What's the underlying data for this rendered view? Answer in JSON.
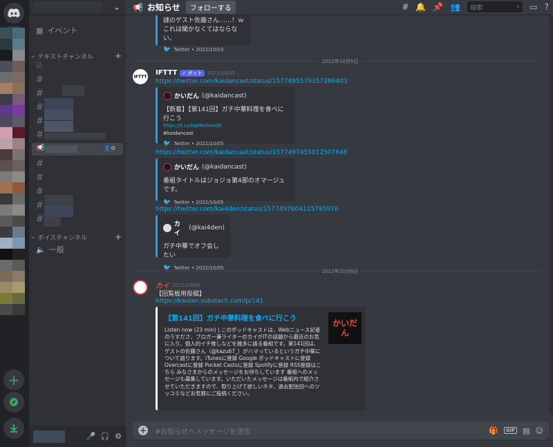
{
  "header": {
    "channel_title": "お知らせ",
    "follow_label": "フォローする",
    "search_placeholder": "検索"
  },
  "sidebar": {
    "event_label": "イベント",
    "text_category": "テキストチャンネル",
    "voice_category": "ボイスチャンネル",
    "voice_channel": "一般"
  },
  "messages": {
    "top_embed": {
      "line1": "謎のゲスト佐藤さん……！ｗ",
      "line2": "これは聞かなくてはならない。",
      "footer": "Twitter • 2022/10/03"
    },
    "date1": "2022年10月5日",
    "ifttt": {
      "name": "IFTTT",
      "bot_badge": "✓ ボット",
      "timestamp": "2022/10/05",
      "link1": "https://twitter.com/kaidancast/status/1577495579357286403",
      "embed1": {
        "author": "かいだん",
        "handle": "(@kaidancast)",
        "text": "【新着】【第141回】ガチ中華料理を食べに行こう",
        "link": "https://t.co/tqeMnhexQE",
        "tag": "#kaidancast",
        "footer": "Twitter • 2022/10/05"
      },
      "link2": "https://twitter.com/kaidancast/status/1577497455012507648",
      "embed2": {
        "author": "かいだん",
        "handle": "(@kaidancast)",
        "text": "番組タイトルはジョジョ第4部のオマージュです。",
        "footer": "Twitter • 2022/10/05"
      },
      "link3": "https://twitter.com/kai4den/status/1577497604115795976",
      "embed3": {
        "author": "カイ",
        "handle": "(@kai4den)",
        "text": "ガチ中華でオフ会したい",
        "footer": "Twitter • 2022/10/05"
      }
    },
    "date2": "2022年10月6日",
    "kai": {
      "name": "カイ",
      "timestamp": "2022/10/06",
      "text": "【回覧板用投稿】",
      "link": "https://kaidan.substack.com/p/141",
      "embed": {
        "title": "【第141回】ガチ中華料理を食べに行こう",
        "body": "Listen now (23 min) | このポッドキャストは、Webニュース記者のうすださ、ブロガー兼ライターのカイがITの話題から最近のお気に入り、個人的イチ推しなどを雑多に語る番組です。第141回は、ゲストの佐藤さん（@kazu67_）がハマっているというガチ中華について語ります。iTunesに登録 Google ポッドキャストに登録 Overcastに登録 Pocket Castsに登録 Spotifyに登録 RSS登録はこちら みなさまからのメッセージをお待ちしています 番組へのメッセージも募集しています。いただいたメッセージは番組内で紹介させていただきますので、取り上げて欲しいネタ、過去配信回へのツッコミなどお気軽にご投稿ください。",
        "thumb_text": "かいだん"
      }
    }
  },
  "composer": {
    "placeholder": "#お知らせへメッセージを送信",
    "gif_label": "GIF"
  },
  "colors": {
    "accent": "#1da1f2",
    "link": "#00aff4",
    "bot": "#5865f2",
    "kai_name": "#e74c3c"
  }
}
